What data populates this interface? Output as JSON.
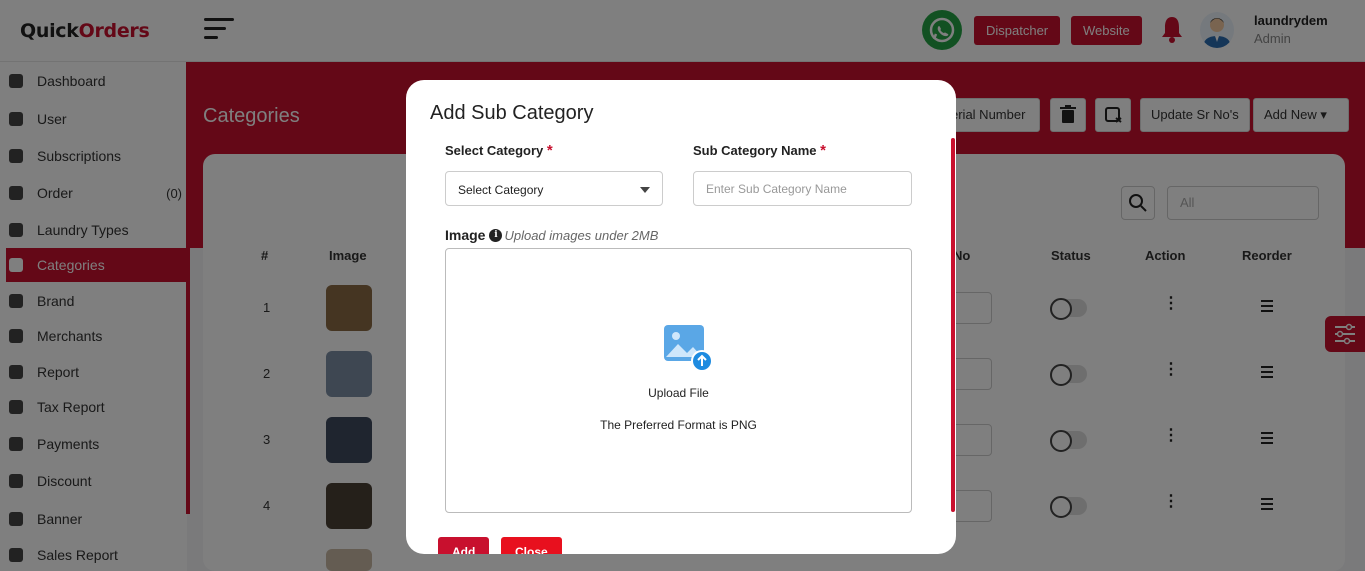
{
  "header": {
    "logo_part1": "Quick",
    "logo_part2": "Orders",
    "dispatcher_label": "Dispatcher",
    "website_label": "Website",
    "user_name": "laundrydem",
    "user_role": "Admin"
  },
  "sidebar": {
    "items": [
      {
        "label": "Dashboard",
        "icon": "dashboard-icon"
      },
      {
        "label": "User",
        "icon": "user-icon"
      },
      {
        "label": "Subscriptions",
        "icon": "crown-icon"
      },
      {
        "label": "Order",
        "icon": "bag-icon",
        "count": "(0)"
      },
      {
        "label": "Laundry Types",
        "icon": "tag-icon"
      },
      {
        "label": "Categories",
        "icon": "categories-icon",
        "active": true
      },
      {
        "label": "Brand",
        "icon": "brand-icon"
      },
      {
        "label": "Merchants",
        "icon": "store-icon"
      },
      {
        "label": "Report",
        "icon": "report-icon"
      },
      {
        "label": "Tax Report",
        "icon": "tax-icon"
      },
      {
        "label": "Payments",
        "icon": "payments-icon"
      },
      {
        "label": "Discount",
        "icon": "discount-icon"
      },
      {
        "label": "Banner",
        "icon": "image-icon"
      },
      {
        "label": "Sales Report",
        "icon": "sales-icon"
      }
    ]
  },
  "page": {
    "title": "Categories",
    "toolbar": {
      "serial_label": "erial Number",
      "update_sr_label": "Update Sr No's",
      "add_new_label": "Add New"
    },
    "filter_value": "All",
    "columns": [
      "#",
      "Image",
      "No",
      "Status",
      "Action",
      "Reorder"
    ],
    "rows": [
      {
        "num": "1"
      },
      {
        "num": "2"
      },
      {
        "num": "3"
      },
      {
        "num": "4"
      }
    ]
  },
  "modal": {
    "title": "Add Sub Category",
    "category_label": "Select Category",
    "required_mark": "*",
    "category_value": "Select Category",
    "subcat_label": "Sub Category Name",
    "subcat_placeholder": "Enter Sub Category Name",
    "image_label": "Image",
    "image_hint": "Upload images under 2MB",
    "upload_text": "Upload File",
    "format_text": "The Preferred Format is PNG",
    "add_label": "Add",
    "close_label": "Close"
  },
  "colors": {
    "brand_red": "#c8102e",
    "whatsapp_green": "#25a244"
  }
}
